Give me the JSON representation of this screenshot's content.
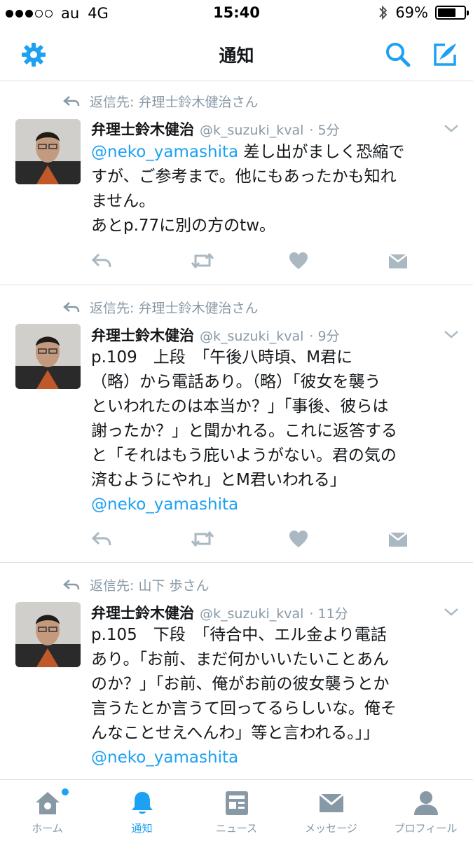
{
  "status_bar": {
    "carrier": "au",
    "network": "4G",
    "time": "15:40",
    "battery": "69%",
    "battery_level": 0.69
  },
  "navbar": {
    "title": "通知"
  },
  "accent_color": "#1da1f2",
  "tweets": [
    {
      "reply_to": "返信先: 弁理士鈴木健治さん",
      "name": "弁理士鈴木健治",
      "handle": "@k_suzuki_kval",
      "time": "· 5分",
      "mention": "@neko_yamashita",
      "lines": [
        " 差し出がましく恐縮で",
        "すが、ご参考まで。他にもあったかも知れ",
        "ません。",
        "あとp.77に別の方のtw。"
      ]
    },
    {
      "reply_to": "返信先: 弁理士鈴木健治さん",
      "name": "弁理士鈴木健治",
      "handle": "@k_suzuki_kval",
      "time": "· 9分",
      "lines": [
        "p.109　上段　「午後八時頃、M君に",
        "（略）から電話あり。（略）「彼女を襲う",
        "といわれたのは本当か？」「事後、彼らは",
        "謝ったか？」と聞かれる。これに返答する",
        "と「それはもう庇いようがない。君の気の",
        "済むようにやれ」とM君いわれる」"
      ],
      "mention": "@neko_yamashita"
    },
    {
      "reply_to": "返信先: 山下 歩さん",
      "name": "弁理士鈴木健治",
      "handle": "@k_suzuki_kval",
      "time": "· 11分",
      "lines": [
        "p.105　下段　「待合中、エル金より電話",
        "あり。「お前、まだ何かいいたいことあん",
        "のか？」「お前、俺がお前の彼女襲うとか",
        "言うたとか言うて回ってるらしいな。俺そ",
        "んなことせえへんわ」等と言われる。」」"
      ],
      "mention": "@neko_yamashita"
    }
  ],
  "tabbar": {
    "items": [
      {
        "label": "ホーム",
        "icon": "home-icon"
      },
      {
        "label": "通知",
        "icon": "bell-icon"
      },
      {
        "label": "ニュース",
        "icon": "news-icon"
      },
      {
        "label": "メッセージ",
        "icon": "envelope-icon"
      },
      {
        "label": "プロフィール",
        "icon": "person-icon"
      }
    ]
  }
}
